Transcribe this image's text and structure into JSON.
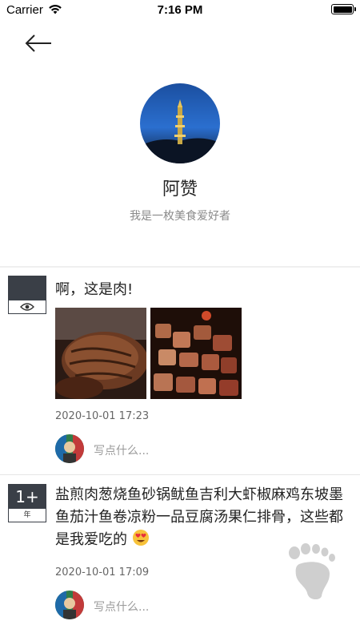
{
  "status_bar": {
    "carrier": "Carrier",
    "time": "7:16 PM"
  },
  "profile": {
    "name": "阿赞",
    "bio": "我是一枚美食爱好者"
  },
  "posts": [
    {
      "text": "啊，这是肉!",
      "time": "2020-10-01 17:23",
      "comment_placeholder": "写点什么..."
    },
    {
      "date_badge_top": "1+",
      "date_badge_bottom": "年",
      "text": "盐煎肉葱烧鱼砂锅鱿鱼吉利大虾椒麻鸡东坡墨鱼茄汁鱼卷凉粉一品豆腐汤果仁排骨，这些都是我爱吃的",
      "emoji": "heart-eyes-emoji",
      "time": "2020-10-01 17:09",
      "comment_placeholder": "写点什么..."
    }
  ],
  "colors": {
    "badge_dark": "#3a3f47",
    "bio_gray": "#8a8a8a",
    "footprint_gray": "#cfcfcf"
  }
}
